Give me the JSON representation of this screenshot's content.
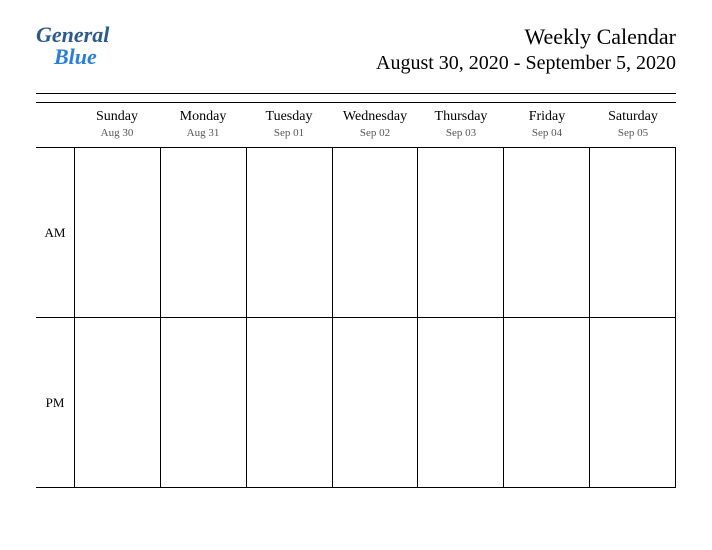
{
  "logo": {
    "part1": "General",
    "part2": "Blue"
  },
  "header": {
    "title": "Weekly Calendar",
    "date_range": "August 30, 2020 - September 5, 2020"
  },
  "days": [
    {
      "name": "Sunday",
      "date": "Aug 30"
    },
    {
      "name": "Monday",
      "date": "Aug 31"
    },
    {
      "name": "Tuesday",
      "date": "Sep 01"
    },
    {
      "name": "Wednesday",
      "date": "Sep 02"
    },
    {
      "name": "Thursday",
      "date": "Sep 03"
    },
    {
      "name": "Friday",
      "date": "Sep 04"
    },
    {
      "name": "Saturday",
      "date": "Sep 05"
    }
  ],
  "rows": [
    {
      "label": "AM"
    },
    {
      "label": "PM"
    }
  ]
}
